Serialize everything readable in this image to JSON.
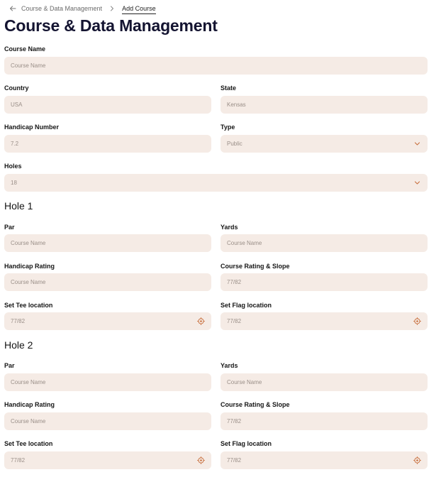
{
  "breadcrumb": {
    "parent": "Course & Data Management",
    "current": "Add Course"
  },
  "page_title": "Course & Data Management",
  "course": {
    "name": {
      "label": "Course Name",
      "placeholder": "Course Name"
    },
    "country": {
      "label": "Country",
      "value": "USA"
    },
    "state": {
      "label": "State",
      "value": "Kensas"
    },
    "handicap_number": {
      "label": "Handicap Number",
      "value": "7.2"
    },
    "type": {
      "label": "Type",
      "value": "Public"
    },
    "holes": {
      "label": "Holes",
      "value": "18"
    }
  },
  "hole1": {
    "title": "Hole 1",
    "par": {
      "label": "Par",
      "placeholder": "Course Name"
    },
    "yards": {
      "label": "Yards",
      "placeholder": "Course Name"
    },
    "handicap_rating": {
      "label": "Handicap Rating",
      "placeholder": "Course Name"
    },
    "course_rating_slope": {
      "label": "Course Rating & Slope",
      "value": "77/82"
    },
    "tee_location": {
      "label": "Set Tee location",
      "value": "77/82"
    },
    "flag_location": {
      "label": "Set Flag location",
      "value": "77/82"
    }
  },
  "hole2": {
    "title": "Hole 2",
    "par": {
      "label": "Par",
      "placeholder": "Course Name"
    },
    "yards": {
      "label": "Yards",
      "placeholder": "Course Name"
    },
    "handicap_rating": {
      "label": "Handicap Rating",
      "placeholder": "Course Name"
    },
    "course_rating_slope": {
      "label": "Course Rating & Slope",
      "value": "77/82"
    },
    "tee_location": {
      "label": "Set Tee location",
      "value": "77/82"
    },
    "flag_location": {
      "label": "Set Flag location",
      "value": "77/82"
    }
  },
  "icons": {
    "back": "arrow-left-icon",
    "separator": "chevron-right-icon",
    "dropdown": "chevron-down-icon",
    "location": "crosshair-icon"
  },
  "colors": {
    "field_bg": "#f5ebe5",
    "accent": "#c8703f",
    "title": "#141431"
  }
}
